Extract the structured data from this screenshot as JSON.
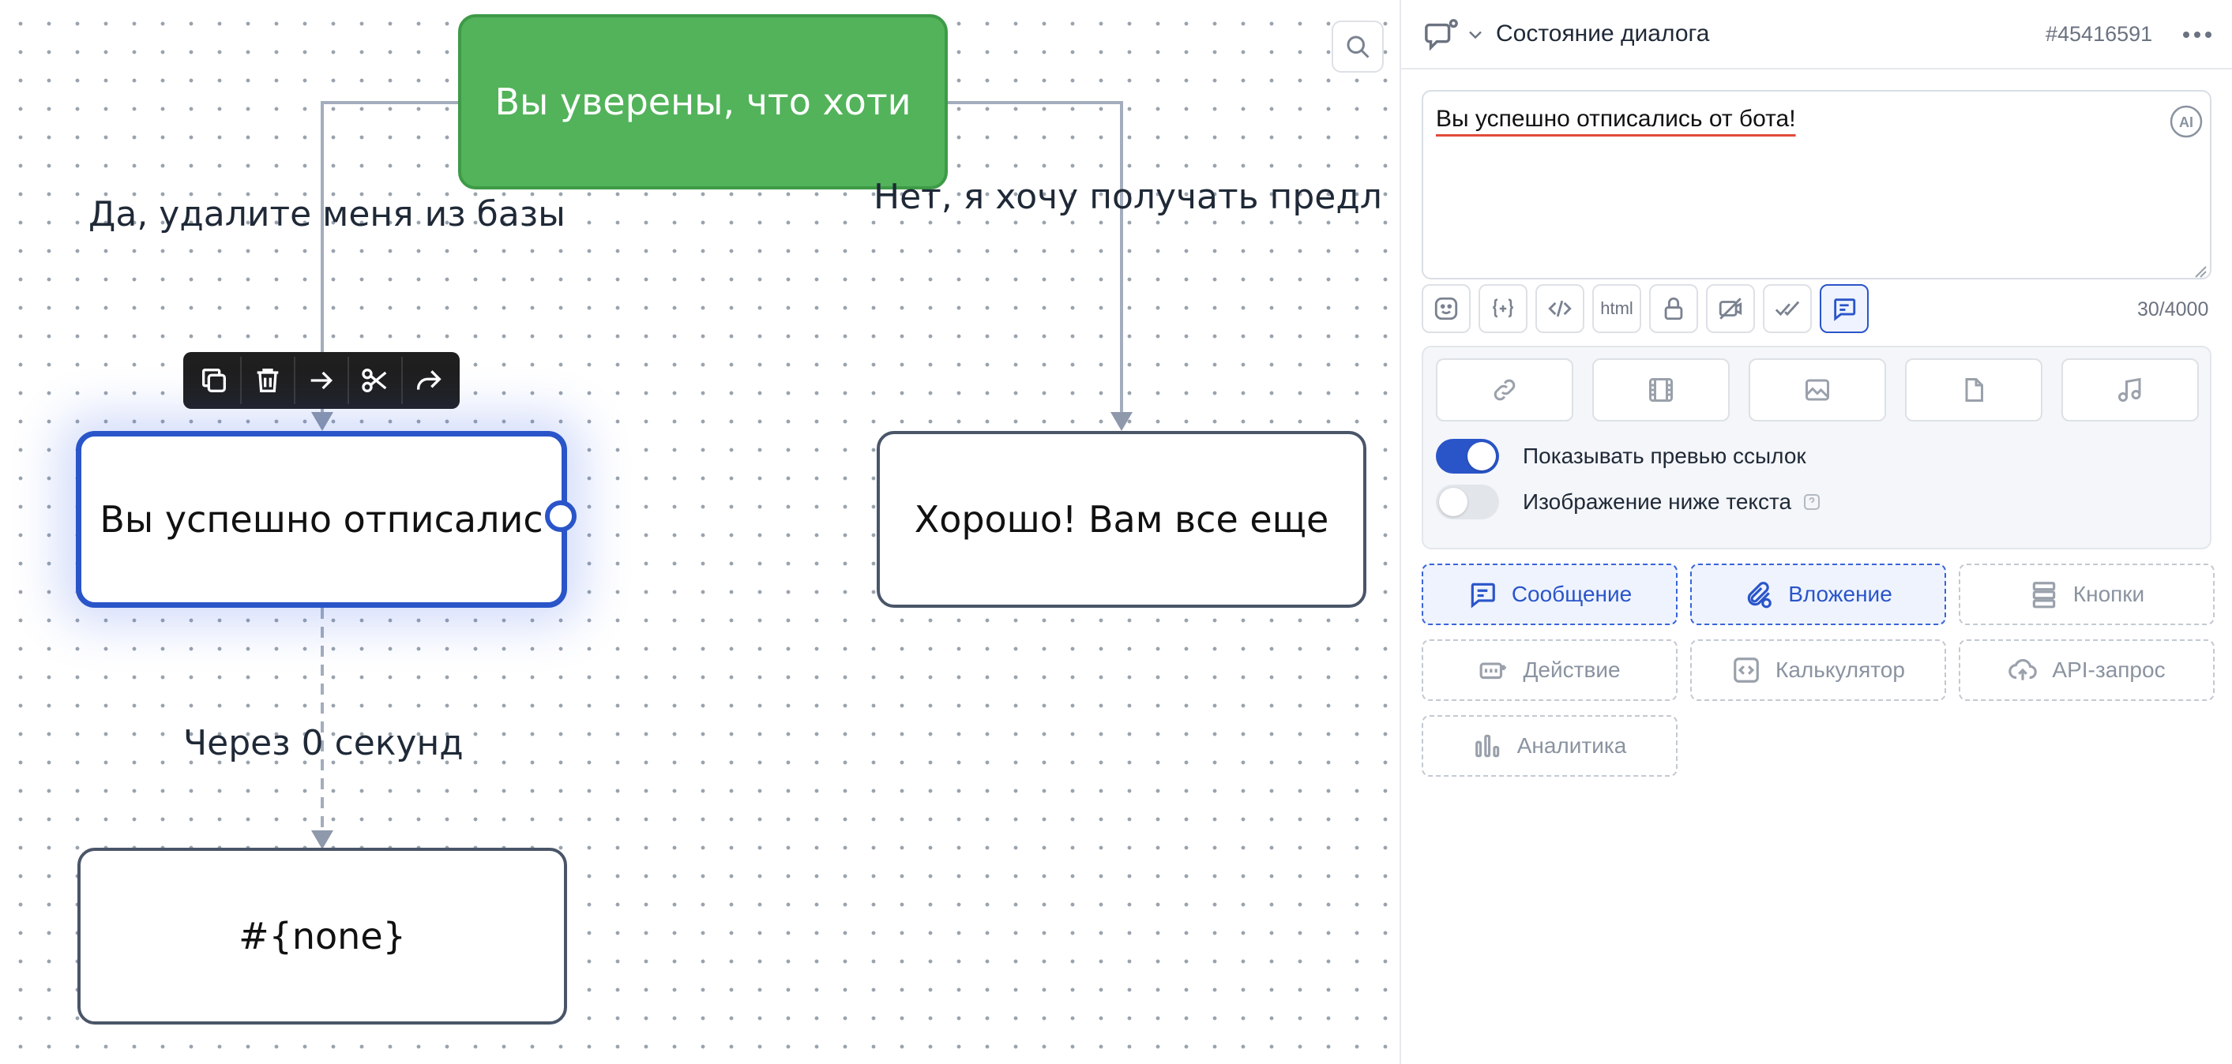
{
  "canvas": {
    "nodes": {
      "question": "Вы уверены, что хоти",
      "unsubscribed": "Вы успешно отписалис",
      "good": "Хорошо!  Вам все еще",
      "none": "#{none}"
    },
    "edge_labels": {
      "yes": "Да, удалите меня из базы",
      "no": "Нет, я хочу получать предл",
      "delay": "Через 0 секунд"
    },
    "node_toolbar_icons": [
      "copy-icon",
      "trash-icon",
      "arrow-right-icon",
      "scissors-icon",
      "share-icon"
    ],
    "colors": {
      "question_node": "#52b35a",
      "selected_border": "#2a55c9",
      "edge": "#a3adbd"
    }
  },
  "panel": {
    "header": {
      "title": "Состояние диалога",
      "id": "#45416591"
    },
    "editor": {
      "text": "Вы успешно отписались от бота!",
      "char_count": "30/4000"
    },
    "format_buttons": {
      "html_label": "html",
      "items": [
        "emoji-icon",
        "variable-icon",
        "code-icon",
        "html",
        "lock-icon",
        "no-preview-icon",
        "double-check-icon",
        "message-icon"
      ]
    },
    "attachments": {
      "media": [
        "link-icon",
        "video-icon",
        "image-icon",
        "file-icon",
        "audio-icon"
      ],
      "toggles": [
        {
          "label": "Показывать превью ссылок",
          "on": true
        },
        {
          "label": "Изображение ниже текста",
          "on": false
        }
      ]
    },
    "block_types": [
      {
        "label": "Сообщение",
        "icon": "message-icon",
        "selected": true
      },
      {
        "label": "Вложение",
        "icon": "attachment-icon",
        "selected": true
      },
      {
        "label": "Кнопки",
        "icon": "buttons-icon",
        "selected": false
      },
      {
        "label": "Действие",
        "icon": "action-icon",
        "selected": false
      },
      {
        "label": "Калькулятор",
        "icon": "calculator-icon",
        "selected": false
      },
      {
        "label": "API-запрос",
        "icon": "cloud-upload-icon",
        "selected": false
      },
      {
        "label": "Аналитика",
        "icon": "analytics-icon",
        "selected": false
      }
    ]
  }
}
